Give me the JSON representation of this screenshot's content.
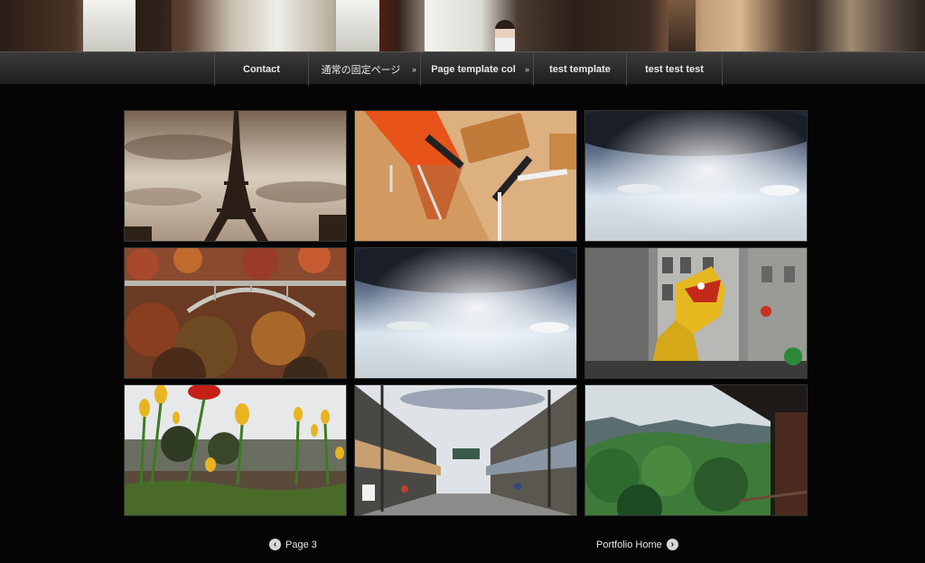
{
  "nav": {
    "items": [
      {
        "label": "Contact",
        "has_dropdown": false
      },
      {
        "label": "通常の固定ページ",
        "has_dropdown": true
      },
      {
        "label": "Page template col",
        "has_dropdown": true
      },
      {
        "label": "test template",
        "has_dropdown": false
      },
      {
        "label": "test test test",
        "has_dropdown": false
      }
    ]
  },
  "gallery": {
    "items": [
      {
        "subject": "eiffel-tower-sepia"
      },
      {
        "subject": "desk-orange-chair"
      },
      {
        "subject": "sky-sunbeams"
      },
      {
        "subject": "autumn-bridge"
      },
      {
        "subject": "sky-sunbeams"
      },
      {
        "subject": "dragon-dance"
      },
      {
        "subject": "tulips"
      },
      {
        "subject": "shopping-street"
      },
      {
        "subject": "mountain-forest"
      }
    ]
  },
  "pager": {
    "prev_label": "Page 3",
    "prev_icon": "chevron-left-circle-icon",
    "next_label": "Portfolio Home",
    "next_icon": "chevron-right-circle-icon"
  }
}
